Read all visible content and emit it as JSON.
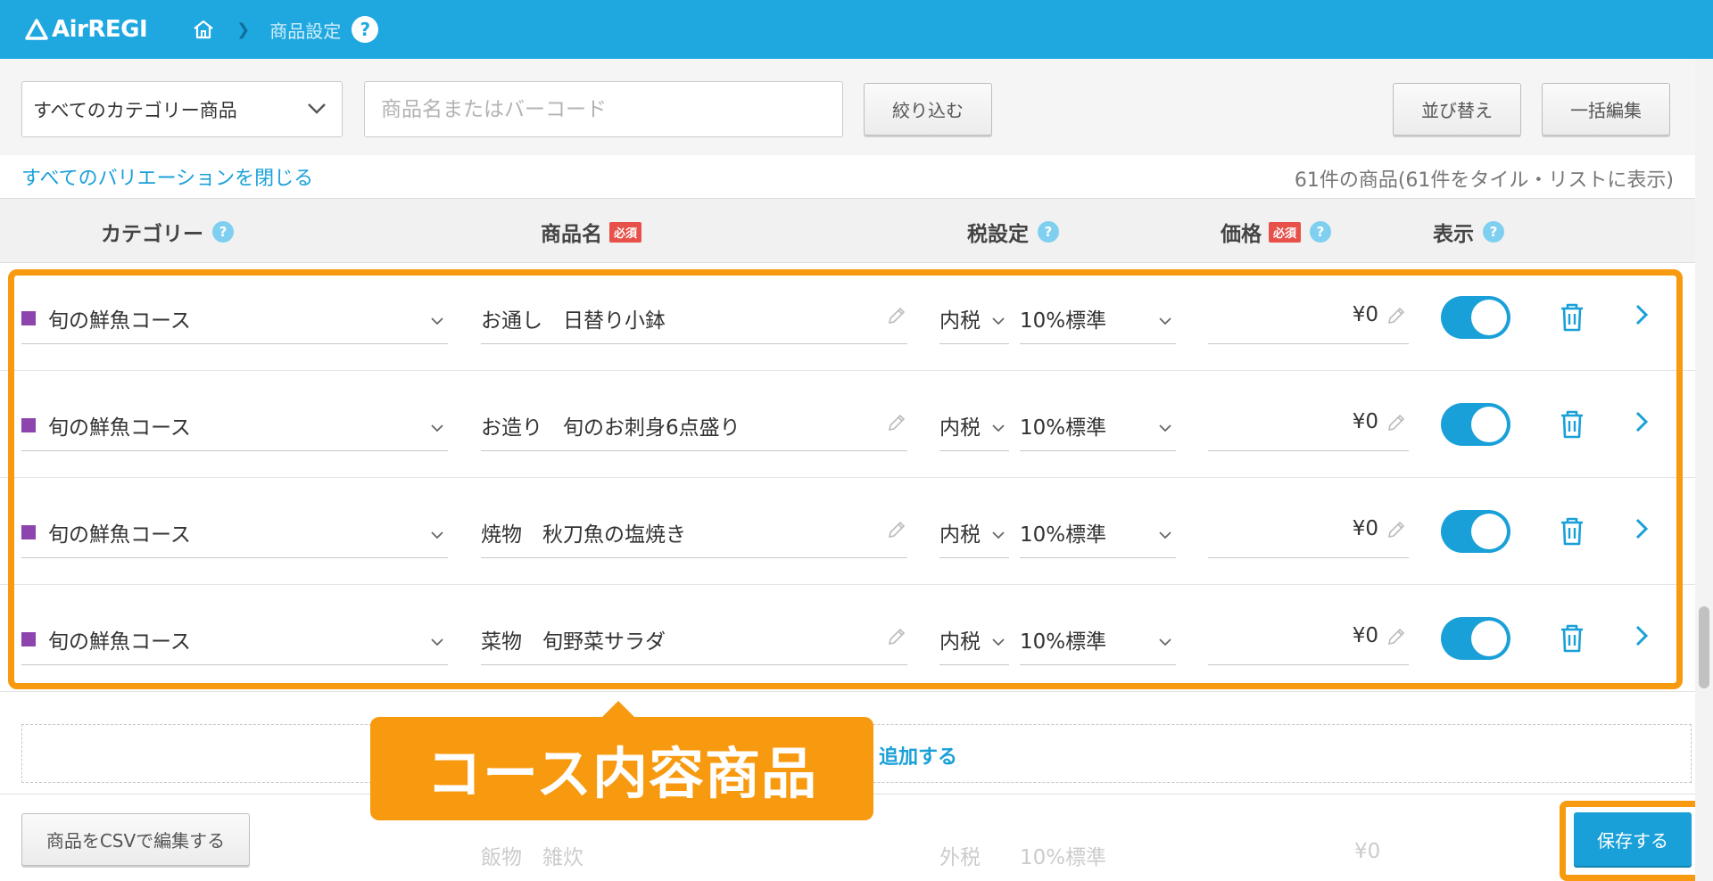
{
  "app": {
    "logo_text": "AirREGI"
  },
  "breadcrumb": {
    "current": "商品設定",
    "help": "?"
  },
  "toolbar": {
    "category_select": "すべてのカテゴリー商品",
    "search_placeholder": "商品名またはバーコード",
    "filter_label": "絞り込む",
    "sort_label": "並び替え",
    "bulk_edit_label": "一括編集"
  },
  "info": {
    "collapse_link": "すべてのバリエーションを閉じる",
    "count_text": "61件の商品(61件をタイル・リストに表示)"
  },
  "table": {
    "headers": {
      "category": "カテゴリー",
      "name": "商品名",
      "tax": "税設定",
      "price": "価格",
      "display": "表示",
      "required_badge": "必須"
    },
    "rows": [
      {
        "category": "旬の鮮魚コース",
        "name": "お通し　日替り小鉢",
        "tax_mode": "内税",
        "tax_rate": "10%標準",
        "price": "¥0",
        "visible": true
      },
      {
        "category": "旬の鮮魚コース",
        "name": "お造り　旬のお刺身6点盛り",
        "tax_mode": "内税",
        "tax_rate": "10%標準",
        "price": "¥0",
        "visible": true
      },
      {
        "category": "旬の鮮魚コース",
        "name": "焼物　秋刀魚の塩焼き",
        "tax_mode": "内税",
        "tax_rate": "10%標準",
        "price": "¥0",
        "visible": true
      },
      {
        "category": "旬の鮮魚コース",
        "name": "菜物　旬野菜サラダ",
        "tax_mode": "内税",
        "tax_rate": "10%標準",
        "price": "¥0",
        "visible": true
      }
    ],
    "ghost_row": {
      "category": "",
      "name": "飯物　雑炊",
      "tax_mode": "外税",
      "tax_rate": "10%標準",
      "price": "¥0"
    },
    "add_link": "追加する"
  },
  "callout": {
    "text": "コース内容商品"
  },
  "footer": {
    "csv_label": "商品をCSVで編集する",
    "save_label": "保存する"
  },
  "colors": {
    "header": "#1fa8e0",
    "accent": "#1aa0d8",
    "highlight": "#f89a10",
    "category_swatch": "#8e44ad",
    "required": "#e8504a"
  }
}
